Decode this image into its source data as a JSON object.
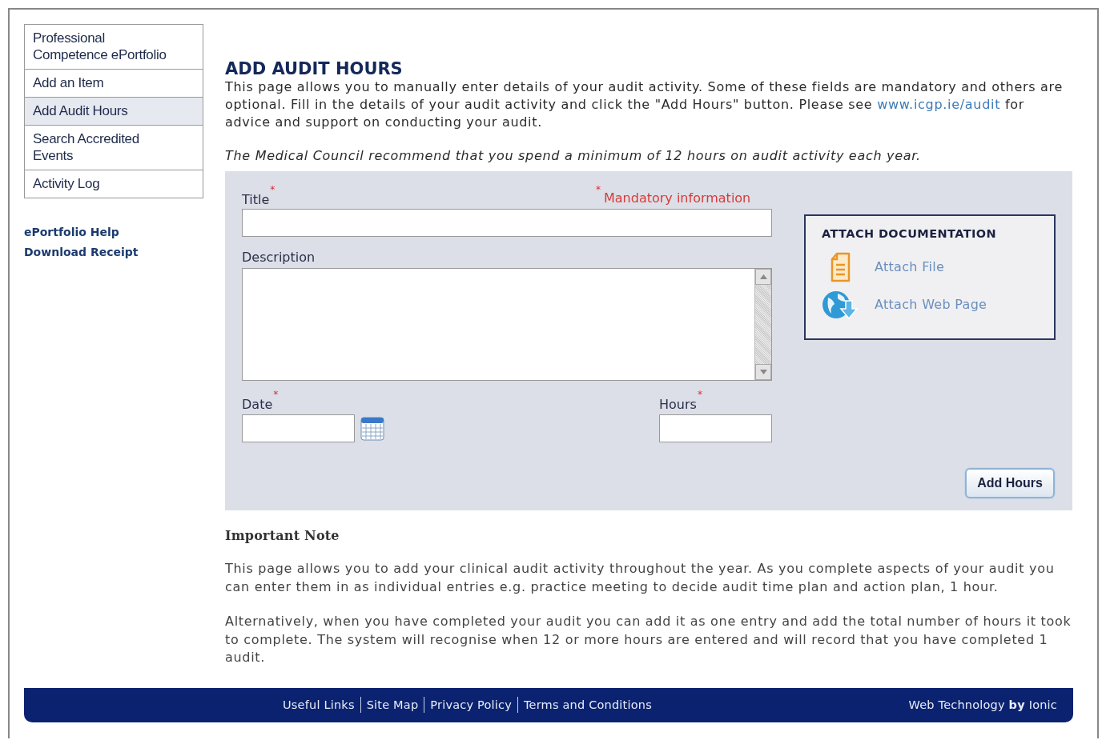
{
  "sidebar": {
    "items": [
      {
        "label": "Professional Competence ePortfolio",
        "selected": false
      },
      {
        "label": "Add an Item",
        "selected": false
      },
      {
        "label": "Add Audit Hours",
        "selected": true
      },
      {
        "label": "Search Accredited Events",
        "selected": false
      },
      {
        "label": "Activity Log",
        "selected": false
      }
    ],
    "links": [
      "ePortfolio Help",
      "Download Receipt"
    ]
  },
  "heading": "ADD AUDIT HOURS",
  "intro": {
    "before": "This page allows you to manually enter details of your audit activity. Some of these fields are mandatory and others are optional. Fill in the details of your audit activity and click the \"Add Hours\" button. Please see",
    "link": "www.icgp.ie/audit",
    "after": "for advice and support on conducting your audit."
  },
  "recommendation": "The Medical Council recommend that you spend a minimum of 12 hours on audit activity each year.",
  "form": {
    "mandatory_legend": {
      "mark": "*",
      "text": "Mandatory information"
    },
    "fields": [
      {
        "kind": "text",
        "label": "Title",
        "required_mark": "*"
      },
      {
        "kind": "textarea",
        "label": "Description"
      },
      {
        "kind": "date",
        "label": "Date",
        "required_mark": "*"
      },
      {
        "kind": "number",
        "label": "Hours",
        "required_mark": "*"
      }
    ],
    "attach": {
      "title": "ATTACH DOCUMENTATION",
      "items": [
        {
          "kind": "file",
          "label": "Attach File"
        },
        {
          "kind": "web",
          "label": "Attach Web Page"
        }
      ]
    },
    "submit": "Add Hours"
  },
  "important_note": {
    "title": "Important Note",
    "paragraphs": [
      "This page allows you to add your clinical audit activity throughout the year. As you complete aspects of your audit you can enter them in as individual entries e.g. practice meeting to decide audit time plan and action plan, 1 hour.",
      "Alternatively, when you have completed your audit you can add it as one entry and add the total number of hours it took to complete. The system will recognise when 12 or more hours are entered and will record that you have completed 1 audit."
    ]
  },
  "footer": {
    "links": [
      "Useful Links",
      "Site Map",
      "Privacy Policy",
      "Terms and Conditions"
    ],
    "credit": "Web Technology **by** Ionic"
  }
}
